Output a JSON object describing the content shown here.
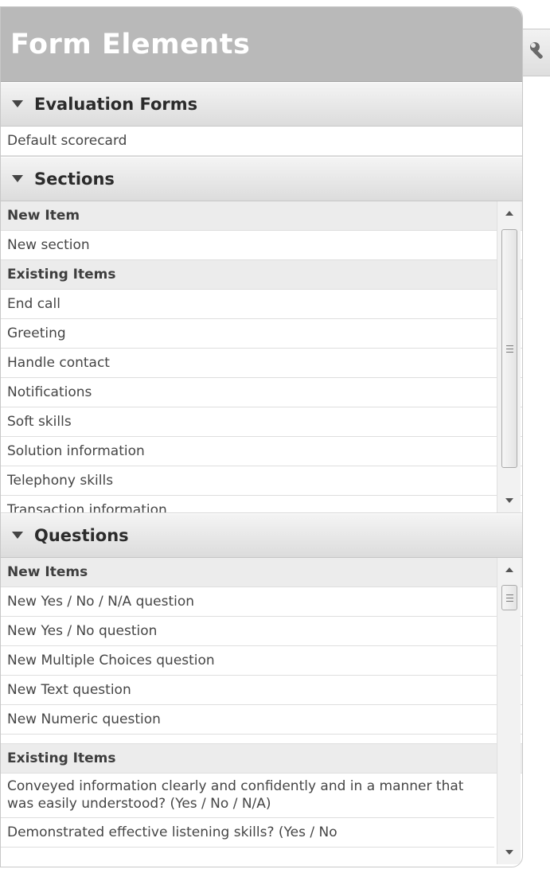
{
  "panel": {
    "title": "Form Elements"
  },
  "evaluation_forms": {
    "header": "Evaluation Forms",
    "items": [
      "Default scorecard"
    ]
  },
  "sections": {
    "header": "Sections",
    "new_group": "New Item",
    "new_items": [
      "New section"
    ],
    "existing_group": "Existing Items",
    "existing_items": [
      "End call",
      "Greeting",
      "Handle contact",
      "Notifications",
      "Soft skills",
      "Solution information",
      "Telephony skills",
      "Transaction information"
    ],
    "scroll_position": 0.6
  },
  "questions": {
    "header": "Questions",
    "new_group": "New Items",
    "new_items": [
      "New Yes / No / N/A question",
      "New Yes / No question",
      "New Multiple Choices question",
      "New Text question",
      "New Numeric question"
    ],
    "existing_group": "Existing Items",
    "existing_items": [
      "Conveyed information clearly and confidently and in a manner that was easily understood? (Yes / No / N/A)",
      "Demonstrated effective listening skills? (Yes / No"
    ],
    "scroll_position": 0.0
  },
  "icons": {
    "side_tab": "wrench-icon",
    "collapse": "triangle-down-icon"
  }
}
